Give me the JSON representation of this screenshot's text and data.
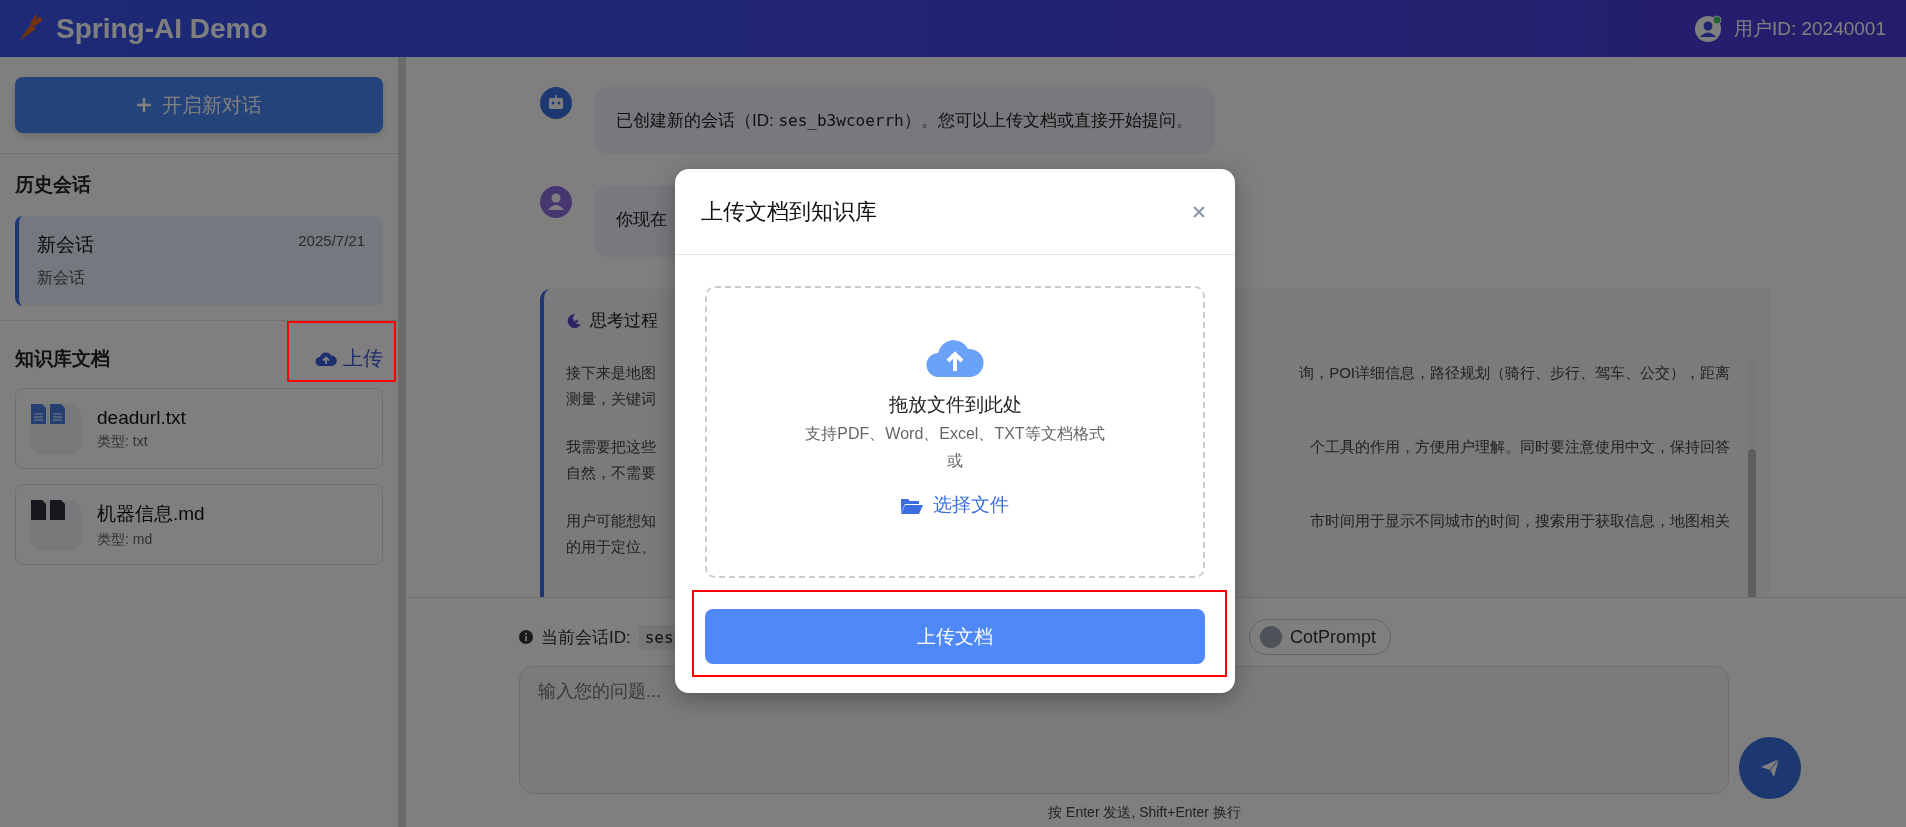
{
  "header": {
    "title": "Spring-AI Demo",
    "user_id": "用户ID: 20240001",
    "online": true
  },
  "sidebar": {
    "new_chat_button": "开启新对话",
    "history_title": "历史会话",
    "sessions": [
      {
        "title": "新会话",
        "date": "2025/7/21",
        "preview": "新会话",
        "selected": true
      }
    ],
    "kb_title": "知识库文档",
    "upload_link": "上传",
    "upload_highlighted": true,
    "documents": [
      {
        "name": "deadurl.txt",
        "type_label": "类型: txt",
        "kind": "txt"
      },
      {
        "name": "机器信息.md",
        "type_label": "类型: md",
        "kind": "md"
      }
    ]
  },
  "chat": {
    "messages": [
      {
        "kind": "assistant",
        "parts": [
          {
            "kind": "text",
            "text": "已创建新的会话（ID: "
          },
          {
            "kind": "code",
            "text": "ses_b3wcoerrh"
          },
          {
            "kind": "text",
            "text": "）。您可以上传文档或直接开始提问。"
          }
        ]
      },
      {
        "kind": "user",
        "parts": [
          {
            "kind": "text",
            "text": "你现在"
          }
        ]
      }
    ],
    "thinking": {
      "title": "思考过程",
      "paragraphs": [
        [
          {
            "left": "接下来是地图",
            "right": "询，POI详细信息，路径规划（骑行、步行、驾车、公交），距离"
          },
          {
            "left": "测量，关键词"
          }
        ],
        [
          {
            "left": "我需要把这些",
            "right": "个工具的作用，方便用户理解。同时要注意使用中文，保持回答"
          },
          {
            "left": "自然，不需要"
          }
        ],
        [
          {
            "left": "用户可能想知",
            "right": "市时间用于显示不同城市的时间，搜索用于获取信息，地图相关"
          },
          {
            "left": "的用于定位、"
          }
        ]
      ]
    }
  },
  "composer": {
    "session_label": "当前会话ID:",
    "session_id": "ses",
    "toggles": [
      {
        "label": "CotPrompt",
        "on": false
      }
    ],
    "placeholder": "输入您的问题...",
    "hint": "按 Enter 发送, Shift+Enter 换行"
  },
  "modal": {
    "title": "上传文档到知识库",
    "drop_title": "拖放文件到此处",
    "formats": "支持PDF、Word、Excel、TXT等文档格式",
    "or": "或",
    "choose_file": "选择文件",
    "submit": "上传文档",
    "submit_highlighted": true
  }
}
